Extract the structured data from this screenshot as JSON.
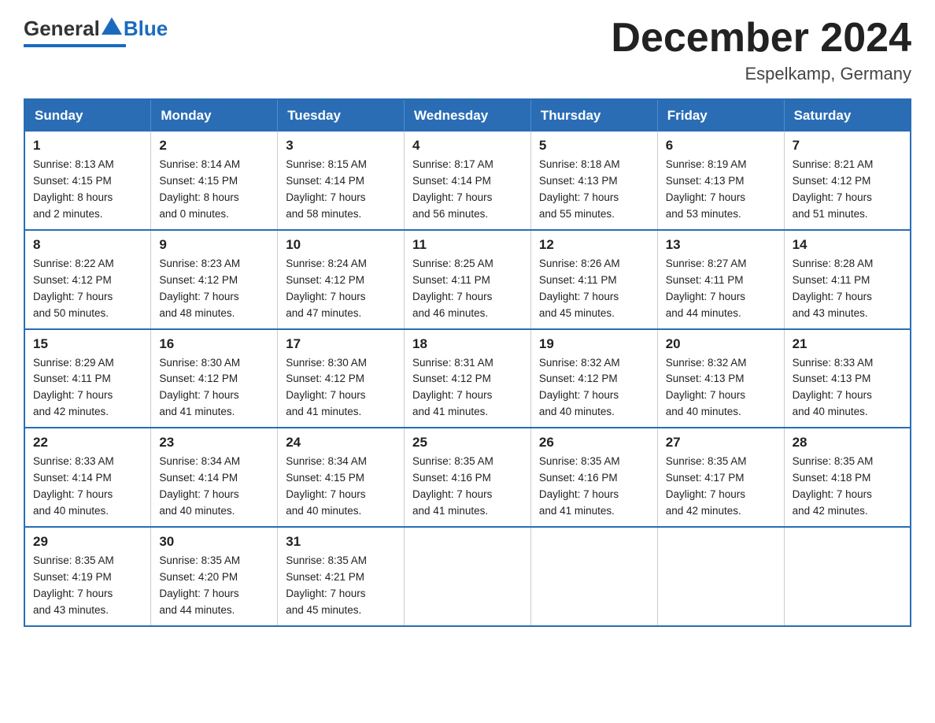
{
  "header": {
    "logo": {
      "general": "General",
      "blue": "Blue"
    },
    "title": "December 2024",
    "location": "Espelkamp, Germany"
  },
  "days_of_week": [
    "Sunday",
    "Monday",
    "Tuesday",
    "Wednesday",
    "Thursday",
    "Friday",
    "Saturday"
  ],
  "weeks": [
    [
      {
        "day": "1",
        "sunrise": "8:13 AM",
        "sunset": "4:15 PM",
        "daylight": "8 hours and 2 minutes."
      },
      {
        "day": "2",
        "sunrise": "8:14 AM",
        "sunset": "4:15 PM",
        "daylight": "8 hours and 0 minutes."
      },
      {
        "day": "3",
        "sunrise": "8:15 AM",
        "sunset": "4:14 PM",
        "daylight": "7 hours and 58 minutes."
      },
      {
        "day": "4",
        "sunrise": "8:17 AM",
        "sunset": "4:14 PM",
        "daylight": "7 hours and 56 minutes."
      },
      {
        "day": "5",
        "sunrise": "8:18 AM",
        "sunset": "4:13 PM",
        "daylight": "7 hours and 55 minutes."
      },
      {
        "day": "6",
        "sunrise": "8:19 AM",
        "sunset": "4:13 PM",
        "daylight": "7 hours and 53 minutes."
      },
      {
        "day": "7",
        "sunrise": "8:21 AM",
        "sunset": "4:12 PM",
        "daylight": "7 hours and 51 minutes."
      }
    ],
    [
      {
        "day": "8",
        "sunrise": "8:22 AM",
        "sunset": "4:12 PM",
        "daylight": "7 hours and 50 minutes."
      },
      {
        "day": "9",
        "sunrise": "8:23 AM",
        "sunset": "4:12 PM",
        "daylight": "7 hours and 48 minutes."
      },
      {
        "day": "10",
        "sunrise": "8:24 AM",
        "sunset": "4:12 PM",
        "daylight": "7 hours and 47 minutes."
      },
      {
        "day": "11",
        "sunrise": "8:25 AM",
        "sunset": "4:11 PM",
        "daylight": "7 hours and 46 minutes."
      },
      {
        "day": "12",
        "sunrise": "8:26 AM",
        "sunset": "4:11 PM",
        "daylight": "7 hours and 45 minutes."
      },
      {
        "day": "13",
        "sunrise": "8:27 AM",
        "sunset": "4:11 PM",
        "daylight": "7 hours and 44 minutes."
      },
      {
        "day": "14",
        "sunrise": "8:28 AM",
        "sunset": "4:11 PM",
        "daylight": "7 hours and 43 minutes."
      }
    ],
    [
      {
        "day": "15",
        "sunrise": "8:29 AM",
        "sunset": "4:11 PM",
        "daylight": "7 hours and 42 minutes."
      },
      {
        "day": "16",
        "sunrise": "8:30 AM",
        "sunset": "4:12 PM",
        "daylight": "7 hours and 41 minutes."
      },
      {
        "day": "17",
        "sunrise": "8:30 AM",
        "sunset": "4:12 PM",
        "daylight": "7 hours and 41 minutes."
      },
      {
        "day": "18",
        "sunrise": "8:31 AM",
        "sunset": "4:12 PM",
        "daylight": "7 hours and 41 minutes."
      },
      {
        "day": "19",
        "sunrise": "8:32 AM",
        "sunset": "4:12 PM",
        "daylight": "7 hours and 40 minutes."
      },
      {
        "day": "20",
        "sunrise": "8:32 AM",
        "sunset": "4:13 PM",
        "daylight": "7 hours and 40 minutes."
      },
      {
        "day": "21",
        "sunrise": "8:33 AM",
        "sunset": "4:13 PM",
        "daylight": "7 hours and 40 minutes."
      }
    ],
    [
      {
        "day": "22",
        "sunrise": "8:33 AM",
        "sunset": "4:14 PM",
        "daylight": "7 hours and 40 minutes."
      },
      {
        "day": "23",
        "sunrise": "8:34 AM",
        "sunset": "4:14 PM",
        "daylight": "7 hours and 40 minutes."
      },
      {
        "day": "24",
        "sunrise": "8:34 AM",
        "sunset": "4:15 PM",
        "daylight": "7 hours and 40 minutes."
      },
      {
        "day": "25",
        "sunrise": "8:35 AM",
        "sunset": "4:16 PM",
        "daylight": "7 hours and 41 minutes."
      },
      {
        "day": "26",
        "sunrise": "8:35 AM",
        "sunset": "4:16 PM",
        "daylight": "7 hours and 41 minutes."
      },
      {
        "day": "27",
        "sunrise": "8:35 AM",
        "sunset": "4:17 PM",
        "daylight": "7 hours and 42 minutes."
      },
      {
        "day": "28",
        "sunrise": "8:35 AM",
        "sunset": "4:18 PM",
        "daylight": "7 hours and 42 minutes."
      }
    ],
    [
      {
        "day": "29",
        "sunrise": "8:35 AM",
        "sunset": "4:19 PM",
        "daylight": "7 hours and 43 minutes."
      },
      {
        "day": "30",
        "sunrise": "8:35 AM",
        "sunset": "4:20 PM",
        "daylight": "7 hours and 44 minutes."
      },
      {
        "day": "31",
        "sunrise": "8:35 AM",
        "sunset": "4:21 PM",
        "daylight": "7 hours and 45 minutes."
      },
      null,
      null,
      null,
      null
    ]
  ],
  "labels": {
    "sunrise": "Sunrise:",
    "sunset": "Sunset:",
    "daylight": "Daylight:"
  }
}
